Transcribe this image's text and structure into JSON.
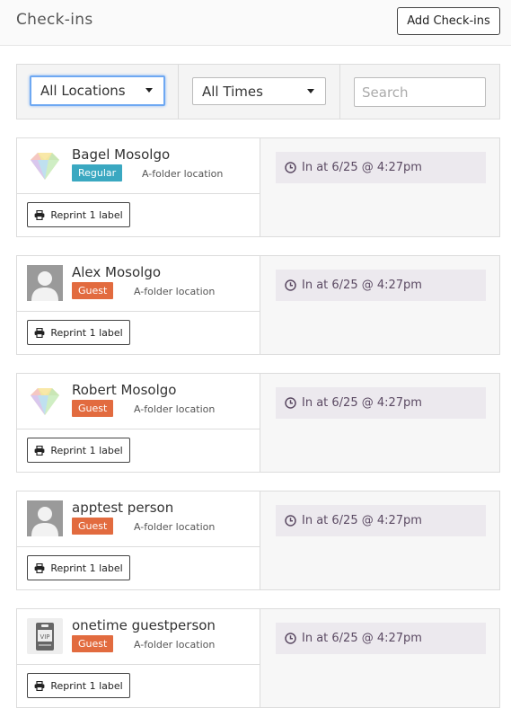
{
  "header": {
    "title": "Check-ins",
    "add_button": "Add Check-ins"
  },
  "filters": {
    "location_select": "All Locations",
    "time_select": "All Times",
    "search_placeholder": "Search"
  },
  "checkins": [
    {
      "name": "Bagel Mosolgo",
      "badge": "Regular",
      "badge_type": "regular",
      "avatar": "gem-avatar-icon",
      "location": "A-folder location",
      "reprint": "Reprint 1 label",
      "time": "In at 6/25 @ 4:27pm"
    },
    {
      "name": "Alex Mosolgo",
      "badge": "Guest",
      "badge_type": "guest",
      "avatar": "person-silhouette-icon",
      "location": "A-folder location",
      "reprint": "Reprint 1 label",
      "time": "In at 6/25 @ 4:27pm"
    },
    {
      "name": "Robert Mosolgo",
      "badge": "Guest",
      "badge_type": "guest",
      "avatar": "gem-avatar-icon",
      "location": "A-folder location",
      "reprint": "Reprint 1 label",
      "time": "In at 6/25 @ 4:27pm"
    },
    {
      "name": "apptest person",
      "badge": "Guest",
      "badge_type": "guest",
      "avatar": "person-silhouette-icon",
      "location": "A-folder location",
      "reprint": "Reprint 1 label",
      "time": "In at 6/25 @ 4:27pm"
    },
    {
      "name": "onetime guestperson",
      "badge": "Guest",
      "badge_type": "guest",
      "avatar": "vip-badge-icon",
      "location": "A-folder location",
      "reprint": "Reprint 1 label",
      "time": "In at 6/25 @ 4:27pm"
    }
  ],
  "colors": {
    "regular_badge": "#3aa8c1",
    "guest_badge": "#e26b3f",
    "time_bg": "#ece9ee",
    "time_text": "#5b4a63",
    "focus_ring": "#6ea8f2"
  },
  "icons": {
    "printer": "printer-icon",
    "clock": "clock-icon",
    "caret": "chevron-down-icon"
  }
}
